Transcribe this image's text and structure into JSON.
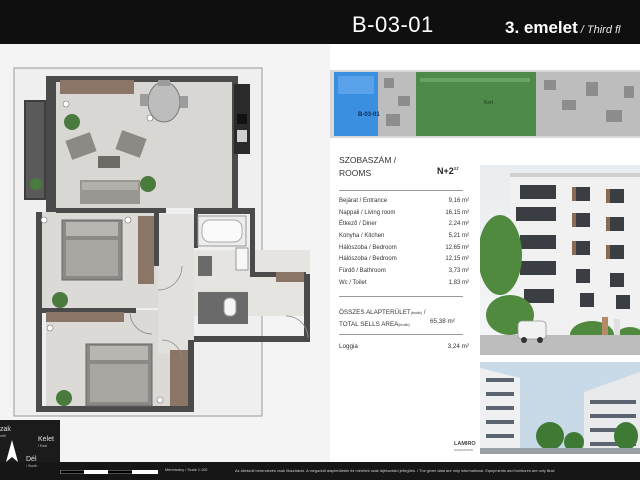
{
  "header": {
    "unit_code": "B-03-01",
    "floor": "3. emelet",
    "floor_sub": "/ Third fl"
  },
  "keyplan": {
    "unit_label": "B-03-01",
    "garden_label": "Kert"
  },
  "summary": {
    "rooms_title_line1": "SZOBASZÁM /",
    "rooms_title_line2": "ROOMS",
    "rooms_count": "N+2",
    "rooms_count_suffix": "sz",
    "rooms": [
      {
        "name": "Bejárat / Entrance",
        "area": "9,16 m²"
      },
      {
        "name": "Nappali / Living room",
        "area": "16,15 m²"
      },
      {
        "name": "Étkező / Diner",
        "area": "2,24 m²"
      },
      {
        "name": "Konyha / Kitchen",
        "area": "5,21 m²"
      },
      {
        "name": "Hálószoba / Bedroom",
        "area": "12,65 m²"
      },
      {
        "name": "Hálószoba / Bedroom",
        "area": "12,15 m²"
      },
      {
        "name": "Fürdő / Bathroom",
        "area": "3,73 m²"
      },
      {
        "name": "Wc / Toilet",
        "area": "1,83 m²"
      }
    ],
    "total_label_line1": "ÖSSZES ALAPTERÜLET",
    "total_label_line1_small": "(bruttó)",
    "total_label_line1_end": " /",
    "total_label_line2": "TOTAL SELLS AREA",
    "total_label_line2_small": "(bruttó)",
    "total_value": "65,38 m²",
    "loggia_label": "Loggia",
    "loggia_value": "3,24 m²"
  },
  "branding": {
    "name": "LAMIRO",
    "sub": "HANGOZATOK"
  },
  "compass": {
    "north_partial": "zak",
    "north_sub_partial": "orth",
    "east": "Kelet",
    "east_sub": "/ East",
    "south": "Dél",
    "south_sub": "/ South"
  },
  "footer": {
    "scale_text": "Méretarány / Scale 1:100",
    "note_text": "Az ábrázolt berendezés csak illusztráció. A megadott alapterületek és méretek csak tájékoztató jellegűek. / The given data are only informational. Equipments and furnitures are only illust"
  },
  "colors": {
    "header_bg": "#0f0f10",
    "unit_highlight": "#3b8fe0",
    "garden": "#4e8a4a",
    "wall": "#4a4a4a",
    "floor_wood": "#d8d6d2"
  }
}
